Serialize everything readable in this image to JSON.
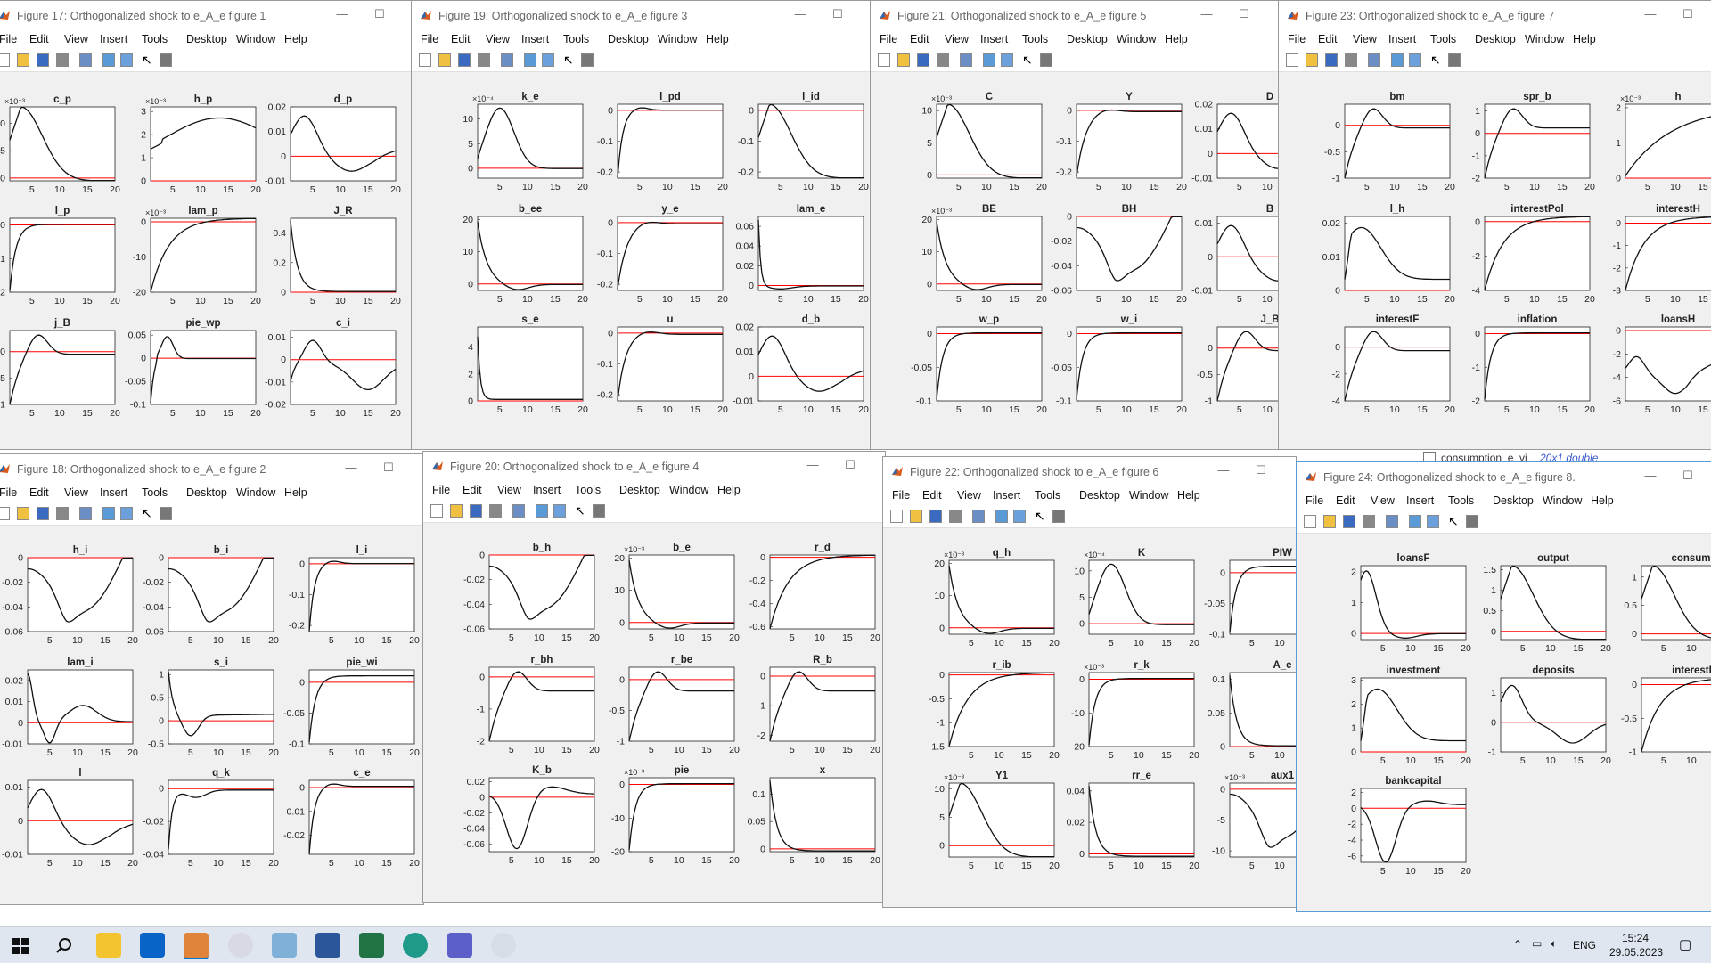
{
  "menu_items": [
    "File",
    "Edit",
    "View",
    "Insert",
    "Tools",
    "Desktop",
    "Window",
    "Help"
  ],
  "windows": [
    {
      "id": "w17",
      "title": "Figure 17: Orthogonalized shock to e_A_e figure 1",
      "plots": [
        {
          "title": "c_p",
          "ticks": [
            "0",
            "5",
            "10"
          ],
          "expo": "×10⁻³",
          "ymin": -0.5,
          "ymax": 13,
          "curve": "c_p"
        },
        {
          "title": "h_p",
          "ticks": [
            "0",
            "1",
            "2",
            "3"
          ],
          "expo": "×10⁻³",
          "ymin": 0,
          "ymax": 3.2,
          "curve": "h_p"
        },
        {
          "title": "d_p",
          "ticks": [
            "-0.01",
            "0",
            "0.01",
            "0.02"
          ],
          "ymin": -0.01,
          "ymax": 0.02,
          "curve": "d_p"
        },
        {
          "title": "l_p",
          "ticks": [
            "-0.2",
            "-0.1",
            "0"
          ],
          "ymin": -0.2,
          "ymax": 0.02,
          "curve": "l_p"
        },
        {
          "title": "lam_p",
          "ticks": [
            "-20",
            "-10",
            "0"
          ],
          "expo": "×10⁻³",
          "ymin": -20,
          "ymax": 1,
          "curve": "lam_p"
        },
        {
          "title": "J_R",
          "ticks": [
            "0",
            "0.2",
            "0.4"
          ],
          "ymin": 0,
          "ymax": 0.5,
          "curve": "J_R"
        },
        {
          "title": "j_B",
          "ticks": [
            "-1",
            "-0.5",
            "0"
          ],
          "ymin": -1,
          "ymax": 0.4,
          "curve": "j_B"
        },
        {
          "title": "pie_wp",
          "ticks": [
            "-0.1",
            "-0.05",
            "0",
            "0.05"
          ],
          "ymin": -0.1,
          "ymax": 0.06,
          "curve": "pie_wp"
        },
        {
          "title": "c_i",
          "ticks": [
            "-0.02",
            "-0.01",
            "0",
            "0.01"
          ],
          "ymin": -0.02,
          "ymax": 0.013,
          "curve": "c_i"
        }
      ]
    },
    {
      "id": "w19",
      "title": "Figure 19: Orthogonalized shock to e_A_e figure 3",
      "plots": [
        {
          "title": "k_e",
          "ticks": [
            "0",
            "5",
            "10"
          ],
          "expo": "×10⁻⁴",
          "ymin": -2,
          "ymax": 13,
          "curve": "k_e"
        },
        {
          "title": "l_pd",
          "ticks": [
            "-0.2",
            "-0.1",
            "0"
          ],
          "ymin": -0.22,
          "ymax": 0.02,
          "curve": "l_pd"
        },
        {
          "title": "l_id",
          "ticks": [
            "-0.2",
            "-0.1",
            "0"
          ],
          "ymin": -0.22,
          "ymax": 0.02,
          "curve": "l_id"
        },
        {
          "title": "b_ee",
          "ticks": [
            "0",
            "10",
            "20"
          ],
          "ymin": -2,
          "ymax": 21,
          "curve": "b_ee"
        },
        {
          "title": "y_e",
          "ticks": [
            "-0.2",
            "-0.1",
            "0"
          ],
          "ymin": -0.22,
          "ymax": 0.02,
          "curve": "y_e"
        },
        {
          "title": "lam_e",
          "ticks": [
            "0",
            "0.02",
            "0.04",
            "0.06"
          ],
          "ymin": -0.005,
          "ymax": 0.07,
          "curve": "lam_e"
        },
        {
          "title": "s_e",
          "ticks": [
            "0",
            "2",
            "4"
          ],
          "ymin": 0,
          "ymax": 5.5,
          "curve": "s_e"
        },
        {
          "title": "u",
          "ticks": [
            "-0.2",
            "-0.1",
            "0"
          ],
          "ymin": -0.22,
          "ymax": 0.02,
          "curve": "u"
        },
        {
          "title": "d_b",
          "ticks": [
            "-0.01",
            "0",
            "0.01",
            "0.02"
          ],
          "ymin": -0.01,
          "ymax": 0.02,
          "curve": "d_p"
        }
      ]
    },
    {
      "id": "w21",
      "title": "Figure 21: Orthogonalized shock to e_A_e figure 5",
      "plots": [
        {
          "title": "C",
          "ticks": [
            "0",
            "5",
            "10"
          ],
          "expo": "×10⁻³",
          "ymin": -0.5,
          "ymax": 11,
          "curve": "c_p"
        },
        {
          "title": "Y",
          "ticks": [
            "-0.2",
            "-0.1",
            "0"
          ],
          "ymin": -0.22,
          "ymax": 0.02,
          "curve": "y_e"
        },
        {
          "title": "D",
          "ticks": [
            "-0.01",
            "0",
            "0.01",
            "0.02"
          ],
          "ymin": -0.01,
          "ymax": 0.02,
          "curve": "d_p"
        },
        {
          "title": "BE",
          "ticks": [
            "0",
            "10",
            "20"
          ],
          "expo": "×10⁻³",
          "ymin": -2,
          "ymax": 21,
          "curve": "b_ee"
        },
        {
          "title": "BH",
          "ticks": [
            "-0.06",
            "-0.04",
            "-0.02",
            "0"
          ],
          "ymin": -0.06,
          "ymax": 0.0,
          "curve": "h_i"
        },
        {
          "title": "B",
          "ticks": [
            "-0.01",
            "0",
            "0.01"
          ],
          "ymin": -0.01,
          "ymax": 0.012,
          "curve": "d_p"
        },
        {
          "title": "w_p",
          "ticks": [
            "-0.1",
            "-0.05",
            "0"
          ],
          "ymin": -0.1,
          "ymax": 0.01,
          "curve": "l_p"
        },
        {
          "title": "w_i",
          "ticks": [
            "-0.1",
            "-0.05",
            "0"
          ],
          "ymin": -0.1,
          "ymax": 0.01,
          "curve": "l_p"
        },
        {
          "title": "J_B",
          "ticks": [
            "-1",
            "-0.5",
            "0"
          ],
          "ymin": -1,
          "ymax": 0.4,
          "curve": "j_B"
        }
      ]
    },
    {
      "id": "w23",
      "title": "Figure 23: Orthogonalized shock to e_A_e figure 7",
      "plots": [
        {
          "title": "bm",
          "ticks": [
            "-1",
            "-0.5",
            "0"
          ],
          "ymin": -1,
          "ymax": 0.4,
          "curve": "j_B"
        },
        {
          "title": "spr_b",
          "ticks": [
            "-2",
            "-1",
            "0",
            "1"
          ],
          "ymin": -2,
          "ymax": 1.3,
          "curve": "j_B"
        },
        {
          "title": "h",
          "ticks": [
            "0",
            "1",
            "2"
          ],
          "expo": "×10⁻³",
          "ymin": 0,
          "ymax": 2.1,
          "curve": "h"
        },
        {
          "title": "l_h",
          "ticks": [
            "0",
            "0.01",
            "0.02"
          ],
          "ymin": 0,
          "ymax": 0.022,
          "curve": "l_h"
        },
        {
          "title": "interestPol",
          "ticks": [
            "-4",
            "-2",
            "0"
          ],
          "ymin": -4,
          "ymax": 0.3,
          "curve": "lam_p"
        },
        {
          "title": "interestH",
          "ticks": [
            "-3",
            "-2",
            "-1",
            "0"
          ],
          "ymin": -3,
          "ymax": 0.3,
          "curve": "lam_p"
        },
        {
          "title": "interestF",
          "ticks": [
            "-4",
            "-2",
            "0"
          ],
          "ymin": -4,
          "ymax": 1.5,
          "curve": "j_B"
        },
        {
          "title": "inflation",
          "ticks": [
            "-2",
            "-1",
            "0"
          ],
          "ymin": -2,
          "ymax": 0.2,
          "curve": "l_p"
        },
        {
          "title": "loansH",
          "ticks": [
            "-6",
            "-4",
            "-2",
            "0"
          ],
          "ymin": -6,
          "ymax": 0.3,
          "curve": "loansH"
        }
      ]
    },
    {
      "id": "w18",
      "title": "Figure 18: Orthogonalized shock to e_A_e figure 2",
      "plots": [
        {
          "title": "h_i",
          "ticks": [
            "-0.06",
            "-0.04",
            "-0.02",
            "0"
          ],
          "ymin": -0.06,
          "ymax": 0.0,
          "curve": "h_i"
        },
        {
          "title": "b_i",
          "ticks": [
            "-0.06",
            "-0.04",
            "-0.02",
            "0"
          ],
          "ymin": -0.06,
          "ymax": 0.0,
          "curve": "h_i"
        },
        {
          "title": "l_i",
          "ticks": [
            "-0.2",
            "-0.1",
            "0"
          ],
          "ymin": -0.22,
          "ymax": 0.02,
          "curve": "l_pd"
        },
        {
          "title": "lam_i",
          "ticks": [
            "-0.01",
            "0",
            "0.01",
            "0.02"
          ],
          "ymin": -0.01,
          "ymax": 0.025,
          "curve": "lam_i"
        },
        {
          "title": "s_i",
          "ticks": [
            "-0.5",
            "0",
            "0.5",
            "1"
          ],
          "ymin": -0.5,
          "ymax": 1.1,
          "curve": "s_i"
        },
        {
          "title": "pie_wi",
          "ticks": [
            "-0.1",
            "-0.05",
            "0"
          ],
          "ymin": -0.1,
          "ymax": 0.02,
          "curve": "l_p"
        },
        {
          "title": "l",
          "ticks": [
            "-0.01",
            "0",
            "0.01"
          ],
          "ymin": -0.01,
          "ymax": 0.012,
          "curve": "d_p"
        },
        {
          "title": "q_k",
          "ticks": [
            "-0.04",
            "-0.02",
            "0"
          ],
          "ymin": -0.04,
          "ymax": 0.005,
          "curve": "q_k"
        },
        {
          "title": "c_e",
          "ticks": [
            "-0.02",
            "-0.01",
            "0"
          ],
          "ymin": -0.028,
          "ymax": 0.003,
          "curve": "l_pd"
        }
      ]
    },
    {
      "id": "w20",
      "title": "Figure 20: Orthogonalized shock to e_A_e figure 4",
      "plots": [
        {
          "title": "b_h",
          "ticks": [
            "-0.06",
            "-0.04",
            "-0.02",
            "0"
          ],
          "ymin": -0.06,
          "ymax": 0.0,
          "curve": "h_i"
        },
        {
          "title": "b_e",
          "ticks": [
            "0",
            "10",
            "20"
          ],
          "expo": "×10⁻³",
          "ymin": -2,
          "ymax": 21,
          "curve": "b_ee"
        },
        {
          "title": "r_d",
          "ticks": [
            "-0.6",
            "-0.4",
            "-0.2",
            "0"
          ],
          "ymin": -0.62,
          "ymax": 0.02,
          "curve": "lam_p"
        },
        {
          "title": "r_bh",
          "ticks": [
            "-2",
            "-1",
            "0"
          ],
          "ymin": -2,
          "ymax": 0.3,
          "curve": "j_B"
        },
        {
          "title": "r_be",
          "ticks": [
            "-1",
            "-0.5",
            "0"
          ],
          "ymin": -1,
          "ymax": 0.2,
          "curve": "j_B"
        },
        {
          "title": "R_b",
          "ticks": [
            "-2",
            "-1",
            "0"
          ],
          "ymin": -2.2,
          "ymax": 0.3,
          "curve": "j_B"
        },
        {
          "title": "K_b",
          "ticks": [
            "-0.06",
            "-0.04",
            "-0.02",
            "0",
            "0.02"
          ],
          "ymin": -0.07,
          "ymax": 0.025,
          "curve": "K_b"
        },
        {
          "title": "pie",
          "ticks": [
            "-20",
            "-10",
            "0"
          ],
          "expo": "×10⁻³",
          "ymin": -20,
          "ymax": 2,
          "curve": "l_p"
        },
        {
          "title": "x",
          "ticks": [
            "0",
            "0.05",
            "0.1"
          ],
          "ymin": -0.005,
          "ymax": 0.13,
          "curve": "J_R"
        }
      ]
    },
    {
      "id": "w22",
      "title": "Figure 22: Orthogonalized shock to e_A_e figure 6",
      "plots": [
        {
          "title": "q_h",
          "ticks": [
            "0",
            "10",
            "20"
          ],
          "expo": "×10⁻³",
          "ymin": -2,
          "ymax": 21,
          "curve": "b_ee"
        },
        {
          "title": "K",
          "ticks": [
            "0",
            "5",
            "10"
          ],
          "expo": "×10⁻⁴",
          "ymin": -2,
          "ymax": 12,
          "curve": "k_e"
        },
        {
          "title": "PIW",
          "ticks": [
            "-0.1",
            "-0.05",
            "0"
          ],
          "ymin": -0.1,
          "ymax": 0.02,
          "curve": "l_p"
        },
        {
          "title": "r_ib",
          "ticks": [
            "-1.5",
            "-1",
            "-0.5",
            "0"
          ],
          "ymin": -1.5,
          "ymax": 0.05,
          "curve": "lam_p"
        },
        {
          "title": "r_k",
          "ticks": [
            "-20",
            "-10",
            "0"
          ],
          "expo": "×10⁻³",
          "ymin": -20,
          "ymax": 2,
          "curve": "l_p"
        },
        {
          "title": "A_e",
          "ticks": [
            "0",
            "0.05",
            "0.1"
          ],
          "ymin": 0,
          "ymax": 0.11,
          "curve": "J_R"
        },
        {
          "title": "Y1",
          "ticks": [
            "0",
            "5",
            "10"
          ],
          "expo": "×10⁻³",
          "ymin": -2,
          "ymax": 11,
          "curve": "c_p"
        },
        {
          "title": "rr_e",
          "ticks": [
            "0",
            "0.02",
            "0.04"
          ],
          "ymin": -0.002,
          "ymax": 0.045,
          "curve": "J_R"
        },
        {
          "title": "aux1",
          "ticks": [
            "-10",
            "-5",
            "0"
          ],
          "expo": "×10⁻³",
          "ymin": -11,
          "ymax": 1,
          "curve": "h_i"
        }
      ]
    },
    {
      "id": "w24",
      "title": "Figure 24: Orthogonalized shock to e_A_e figure 8.",
      "plots": [
        {
          "title": "loansF",
          "ticks": [
            "0",
            "1",
            "2"
          ],
          "ymin": -0.2,
          "ymax": 2.2,
          "curve": "loansF"
        },
        {
          "title": "output",
          "ticks": [
            "0",
            "0.5",
            "1",
            "1.5"
          ],
          "ymin": -0.2,
          "ymax": 1.6,
          "curve": "c_p"
        },
        {
          "title": "consump",
          "ticks": [
            "0",
            "0.5",
            "1"
          ],
          "ymin": -0.1,
          "ymax": 1.2,
          "curve": "c_p"
        },
        {
          "title": "investment",
          "ticks": [
            "0",
            "1",
            "2",
            "3"
          ],
          "ymin": 0,
          "ymax": 3.1,
          "curve": "l_h"
        },
        {
          "title": "deposits",
          "ticks": [
            "-1",
            "0",
            "1"
          ],
          "ymin": -1,
          "ymax": 1.5,
          "curve": "deposits"
        },
        {
          "title": "interestD",
          "ticks": [
            "-1",
            "-0.5",
            "0"
          ],
          "ymin": -1,
          "ymax": 0.1,
          "curve": "lam_p"
        },
        {
          "title": "bankcapital",
          "ticks": [
            "-6",
            "-4",
            "-2",
            "0",
            "2"
          ],
          "ymin": -6.8,
          "ymax": 2.5,
          "curve": "bankcap"
        }
      ]
    }
  ],
  "xticks": [
    "5",
    "10",
    "15",
    "20"
  ],
  "desktop": {
    "var_name": "consumption_e_vi",
    "var_size": "20x1 double"
  },
  "taskbar": {
    "lang": "ENG",
    "time": "15:24",
    "date": "29.05.2023"
  },
  "colors": {
    "curve": "#111111",
    "zero_line": "#ff0000",
    "window_bg": "#f0f0f0",
    "taskbar": "#dfe6ef",
    "accent": "#0078d7"
  }
}
